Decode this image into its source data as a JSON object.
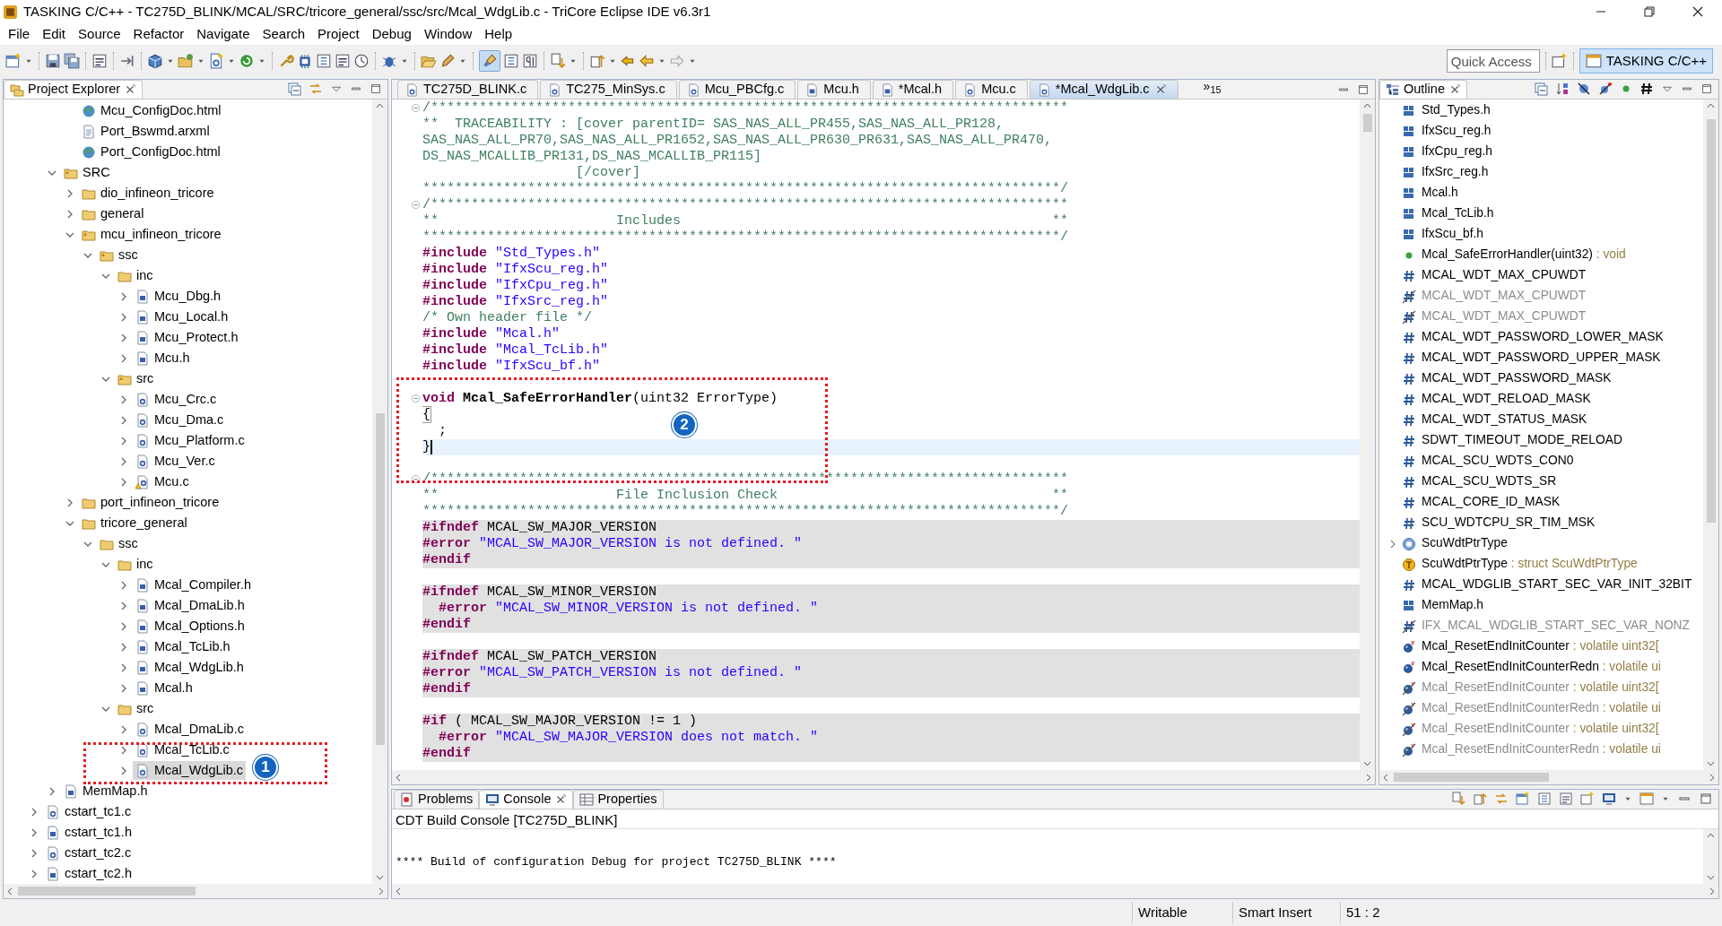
{
  "window": {
    "title": "TASKING C/C++ - TC275D_BLINK/MCAL/SRC/tricore_general/ssc/src/Mcal_WdgLib.c - TriCore Eclipse IDE v6.3r1"
  },
  "menu": [
    "File",
    "Edit",
    "Source",
    "Refactor",
    "Navigate",
    "Search",
    "Project",
    "Debug",
    "Window",
    "Help"
  ],
  "toolbar": {
    "toggle": {
      "on": true
    },
    "quick_access": {
      "placeholder": "Quick Access"
    },
    "perspectives": [
      {
        "label": "TASKING C/C++",
        "selected": true
      }
    ]
  },
  "project_explorer": {
    "title": "Project Explorer",
    "callout": "1",
    "tree": [
      {
        "kind": "hidden",
        "children": [
          {
            "kind": "hidden",
            "children": [
              {
                "label": "Mcu_ConfigDoc.html",
                "kind": "web",
                "selected": false
              },
              {
                "label": "Port_Bswmd.arxml",
                "kind": "doc",
                "selected": false
              },
              {
                "label": "Port_ConfigDoc.html",
                "kind": "web",
                "selected": false
              }
            ]
          },
          {
            "label": "SRC",
            "kind": "srcfolder",
            "expanded": true,
            "selected": false,
            "children": [
              {
                "label": "dio_infineon_tricore",
                "kind": "folder",
                "expanded": false,
                "selected": false
              },
              {
                "label": "general",
                "kind": "folder",
                "expanded": false,
                "selected": false
              },
              {
                "label": "mcu_infineon_tricore",
                "kind": "srcfolder",
                "expanded": true,
                "selected": false,
                "children": [
                  {
                    "label": "ssc",
                    "kind": "srcfolder",
                    "expanded": true,
                    "selected": false,
                    "children": [
                      {
                        "label": "inc",
                        "kind": "folder",
                        "expanded": true,
                        "selected": false,
                        "children": [
                          {
                            "label": "Mcu_Dbg.h",
                            "kind": "h",
                            "expanded": false,
                            "selected": false
                          },
                          {
                            "label": "Mcu_Local.h",
                            "kind": "h",
                            "expanded": false,
                            "selected": false
                          },
                          {
                            "label": "Mcu_Protect.h",
                            "kind": "h",
                            "expanded": false,
                            "selected": false
                          },
                          {
                            "label": "Mcu.h",
                            "kind": "h",
                            "expanded": false,
                            "selected": false
                          }
                        ]
                      },
                      {
                        "label": "src",
                        "kind": "srcfolder",
                        "expanded": true,
                        "selected": false,
                        "children": [
                          {
                            "label": "Mcu_Crc.c",
                            "kind": "c",
                            "expanded": false,
                            "selected": false
                          },
                          {
                            "label": "Mcu_Dma.c",
                            "kind": "c",
                            "expanded": false,
                            "selected": false
                          },
                          {
                            "label": "Mcu_Platform.c",
                            "kind": "c",
                            "expanded": false,
                            "selected": false
                          },
                          {
                            "label": "Mcu_Ver.c",
                            "kind": "c",
                            "expanded": false,
                            "selected": false
                          },
                          {
                            "label": "Mcu.c",
                            "kind": "c_warning",
                            "expanded": false,
                            "selected": false
                          }
                        ]
                      }
                    ]
                  }
                ]
              },
              {
                "label": "port_infineon_tricore",
                "kind": "folder",
                "expanded": false,
                "selected": false
              },
              {
                "label": "tricore_general",
                "kind": "folder",
                "expanded": true,
                "selected": false,
                "children": [
                  {
                    "label": "ssc",
                    "kind": "folder",
                    "expanded": true,
                    "selected": false,
                    "children": [
                      {
                        "label": "inc",
                        "kind": "folder",
                        "expanded": true,
                        "selected": false,
                        "children": [
                          {
                            "label": "Mcal_Compiler.h",
                            "kind": "h",
                            "expanded": false,
                            "selected": false
                          },
                          {
                            "label": "Mcal_DmaLib.h",
                            "kind": "h",
                            "expanded": false,
                            "selected": false
                          },
                          {
                            "label": "Mcal_Options.h",
                            "kind": "h",
                            "expanded": false,
                            "selected": false
                          },
                          {
                            "label": "Mcal_TcLib.h",
                            "kind": "h",
                            "expanded": false,
                            "selected": false
                          },
                          {
                            "label": "Mcal_WdgLib.h",
                            "kind": "h",
                            "expanded": false,
                            "selected": false
                          },
                          {
                            "label": "Mcal.h",
                            "kind": "h",
                            "expanded": false,
                            "selected": false
                          }
                        ]
                      },
                      {
                        "label": "src",
                        "kind": "folder",
                        "expanded": true,
                        "selected": false,
                        "children": [
                          {
                            "label": "Mcal_DmaLib.c",
                            "kind": "c",
                            "expanded": false,
                            "selected": false
                          },
                          {
                            "label": "Mcal_TcLib.c",
                            "kind": "c",
                            "expanded": false,
                            "selected": false
                          },
                          {
                            "label": "Mcal_WdgLib.c",
                            "kind": "c",
                            "expanded": false,
                            "selected": true
                          }
                        ]
                      }
                    ]
                  }
                ]
              }
            ]
          },
          {
            "label": "MemMap.h",
            "kind": "h",
            "expanded": false,
            "selected": false
          }
        ]
      },
      {
        "label": "cstart_tc1.c",
        "kind": "c",
        "expanded": false,
        "selected": false
      },
      {
        "label": "cstart_tc1.h",
        "kind": "h",
        "expanded": false,
        "selected": false
      },
      {
        "label": "cstart_tc2.c",
        "kind": "c",
        "expanded": false,
        "selected": false
      },
      {
        "label": "cstart_tc2.h",
        "kind": "h",
        "expanded": false,
        "selected": false
      }
    ]
  },
  "editor": {
    "tabs": [
      {
        "label": "TC275D_BLINK.c",
        "kind": "c",
        "selected": false
      },
      {
        "label": "TC275_MinSys.c",
        "kind": "c",
        "selected": false
      },
      {
        "label": "Mcu_PBCfg.c",
        "kind": "c",
        "selected": false
      },
      {
        "label": "Mcu.h",
        "kind": "h",
        "selected": false
      },
      {
        "label": "*Mcal.h",
        "kind": "h",
        "selected": false
      },
      {
        "label": "Mcu.c",
        "kind": "c",
        "selected": false
      },
      {
        "label": "*Mcal_WdgLib.c",
        "kind": "c",
        "selected": true
      }
    ],
    "overflow": {
      "mark": "»",
      "count": "15"
    },
    "callout": "2",
    "lines": [
      {
        "fold": true,
        "inactive": false,
        "current": false,
        "segments": [
          {
            "kind": "comment",
            "text": "/*******************************************************************************"
          }
        ]
      },
      {
        "fold": false,
        "inactive": false,
        "current": false,
        "segments": [
          {
            "kind": "comment",
            "text": "**  TRACEABILITY : [cover parentID= SAS_NAS_ALL_PR455,SAS_NAS_ALL_PR128,"
          }
        ]
      },
      {
        "fold": false,
        "inactive": false,
        "current": false,
        "segments": [
          {
            "kind": "comment",
            "text": "SAS_NAS_ALL_PR70,SAS_NAS_ALL_PR1652,SAS_NAS_ALL_PR630_PR631,SAS_NAS_ALL_PR470,"
          }
        ]
      },
      {
        "fold": false,
        "inactive": false,
        "current": false,
        "segments": [
          {
            "kind": "comment",
            "text": "DS_NAS_MCALLIB_PR131,DS_NAS_MCALLIB_PR115]"
          }
        ]
      },
      {
        "fold": false,
        "inactive": false,
        "current": false,
        "segments": [
          {
            "kind": "comment",
            "text": "                   [/cover]"
          }
        ]
      },
      {
        "fold": false,
        "inactive": false,
        "current": false,
        "segments": [
          {
            "kind": "comment",
            "text": "*******************************************************************************/"
          }
        ]
      },
      {
        "fold": true,
        "inactive": false,
        "current": false,
        "segments": [
          {
            "kind": "comment",
            "text": "/*******************************************************************************"
          }
        ]
      },
      {
        "fold": false,
        "inactive": false,
        "current": false,
        "segments": [
          {
            "kind": "comment",
            "text": "**                      Includes                                              **"
          }
        ]
      },
      {
        "fold": false,
        "inactive": false,
        "current": false,
        "segments": [
          {
            "kind": "comment",
            "text": "*******************************************************************************/"
          }
        ]
      },
      {
        "fold": false,
        "inactive": false,
        "current": false,
        "segments": [
          {
            "kind": "directive",
            "text": "#include"
          },
          {
            "kind": "string",
            "text": " \"Std_Types.h\""
          }
        ]
      },
      {
        "fold": false,
        "inactive": false,
        "current": false,
        "segments": [
          {
            "kind": "directive",
            "text": "#include"
          },
          {
            "kind": "string",
            "text": " \"IfxScu_reg.h\""
          }
        ]
      },
      {
        "fold": false,
        "inactive": false,
        "current": false,
        "segments": [
          {
            "kind": "directive",
            "text": "#include"
          },
          {
            "kind": "string",
            "text": " \"IfxCpu_reg.h\""
          }
        ]
      },
      {
        "fold": false,
        "inactive": false,
        "current": false,
        "segments": [
          {
            "kind": "directive",
            "text": "#include"
          },
          {
            "kind": "string",
            "text": " \"IfxSrc_reg.h\""
          }
        ]
      },
      {
        "fold": false,
        "inactive": false,
        "current": false,
        "segments": [
          {
            "kind": "comment",
            "text": "/* Own header file */"
          }
        ]
      },
      {
        "fold": false,
        "inactive": false,
        "current": false,
        "segments": [
          {
            "kind": "directive",
            "text": "#include"
          },
          {
            "kind": "string",
            "text": " \"Mcal.h\""
          }
        ]
      },
      {
        "fold": false,
        "inactive": false,
        "current": false,
        "segments": [
          {
            "kind": "directive",
            "text": "#include"
          },
          {
            "kind": "string",
            "text": " \"Mcal_TcLib.h\""
          }
        ]
      },
      {
        "fold": false,
        "inactive": false,
        "current": false,
        "segments": [
          {
            "kind": "directive",
            "text": "#include"
          },
          {
            "kind": "string",
            "text": " \"IfxScu_bf.h\""
          }
        ]
      },
      {
        "fold": false,
        "inactive": false,
        "current": false
      },
      {
        "fold": true,
        "inactive": false,
        "current": false,
        "segments": [
          {
            "kind": "keyword",
            "text": "void "
          },
          {
            "kind": "func",
            "text": "Mcal_SafeErrorHandler"
          },
          {
            "kind": "plain",
            "text": "(uint32 ErrorType)"
          }
        ]
      },
      {
        "fold": false,
        "inactive": false,
        "current": false,
        "segments": [
          {
            "kind": "match",
            "text": "{"
          }
        ]
      },
      {
        "fold": false,
        "inactive": false,
        "current": false,
        "segments": [
          {
            "kind": "plain",
            "text": "  ;"
          }
        ]
      },
      {
        "fold": false,
        "inactive": false,
        "current": true,
        "segments": [
          {
            "kind": "plain",
            "text": "}"
          }
        ]
      },
      {
        "fold": false,
        "inactive": false,
        "current": false
      },
      {
        "fold": true,
        "inactive": false,
        "current": false,
        "segments": [
          {
            "kind": "comment",
            "text": "/*******************************************************************************"
          }
        ]
      },
      {
        "fold": false,
        "inactive": false,
        "current": false,
        "segments": [
          {
            "kind": "comment",
            "text": "**                      File Inclusion Check                                  **"
          }
        ]
      },
      {
        "fold": false,
        "inactive": false,
        "current": false,
        "segments": [
          {
            "kind": "comment",
            "text": "*******************************************************************************/"
          }
        ]
      },
      {
        "fold": false,
        "inactive": true,
        "current": false,
        "segments": [
          {
            "kind": "directive",
            "text": "#ifndef"
          },
          {
            "kind": "plain",
            "text": " MCAL_SW_MAJOR_VERSION"
          }
        ]
      },
      {
        "fold": false,
        "inactive": true,
        "current": false,
        "segments": [
          {
            "kind": "directive",
            "text": "#error"
          },
          {
            "kind": "string",
            "text": " \"MCAL_SW_MAJOR_VERSION is not defined. \""
          }
        ]
      },
      {
        "fold": false,
        "inactive": true,
        "current": false,
        "segments": [
          {
            "kind": "directive",
            "text": "#endif"
          }
        ]
      },
      {
        "fold": false,
        "inactive": false,
        "current": false
      },
      {
        "fold": false,
        "inactive": true,
        "current": false,
        "segments": [
          {
            "kind": "directive",
            "text": "#ifndef"
          },
          {
            "kind": "plain",
            "text": " MCAL_SW_MINOR_VERSION"
          }
        ]
      },
      {
        "fold": false,
        "inactive": true,
        "current": false,
        "segments": [
          {
            "kind": "directive",
            "text": "  #error"
          },
          {
            "kind": "string",
            "text": " \"MCAL_SW_MINOR_VERSION is not defined. \""
          }
        ]
      },
      {
        "fold": false,
        "inactive": true,
        "current": false,
        "segments": [
          {
            "kind": "directive",
            "text": "#endif"
          }
        ]
      },
      {
        "fold": false,
        "inactive": false,
        "current": false
      },
      {
        "fold": false,
        "inactive": true,
        "current": false,
        "segments": [
          {
            "kind": "directive",
            "text": "#ifndef"
          },
          {
            "kind": "plain",
            "text": " MCAL_SW_PATCH_VERSION"
          }
        ]
      },
      {
        "fold": false,
        "inactive": true,
        "current": false,
        "segments": [
          {
            "kind": "directive",
            "text": "#error"
          },
          {
            "kind": "string",
            "text": " \"MCAL_SW_PATCH_VERSION is not defined. \""
          }
        ]
      },
      {
        "fold": false,
        "inactive": true,
        "current": false,
        "segments": [
          {
            "kind": "directive",
            "text": "#endif"
          }
        ]
      },
      {
        "fold": false,
        "inactive": false,
        "current": false
      },
      {
        "fold": false,
        "inactive": true,
        "current": false,
        "segments": [
          {
            "kind": "directive",
            "text": "#if"
          },
          {
            "kind": "plain",
            "text": " ( MCAL_SW_MAJOR_VERSION != 1 )"
          }
        ]
      },
      {
        "fold": false,
        "inactive": true,
        "current": false,
        "segments": [
          {
            "kind": "directive",
            "text": "  #error"
          },
          {
            "kind": "string",
            "text": " \"MCAL_SW_MAJOR_VERSION does not match. \""
          }
        ]
      },
      {
        "fold": false,
        "inactive": true,
        "current": false,
        "segments": [
          {
            "kind": "directive",
            "text": "#endif"
          }
        ]
      }
    ]
  },
  "outline": {
    "title": "Outline",
    "items": [
      {
        "label": "Std_Types.h",
        "kind": "include",
        "disabled": false
      },
      {
        "label": "IfxScu_reg.h",
        "kind": "include",
        "disabled": false
      },
      {
        "label": "IfxCpu_reg.h",
        "kind": "include",
        "disabled": false
      },
      {
        "label": "IfxSrc_reg.h",
        "kind": "include",
        "disabled": false
      },
      {
        "label": "Mcal.h",
        "kind": "include",
        "disabled": false
      },
      {
        "label": "Mcal_TcLib.h",
        "kind": "include",
        "disabled": false
      },
      {
        "label": "IfxScu_bf.h",
        "kind": "include",
        "disabled": false
      },
      {
        "label": "Mcal_SafeErrorHandler(uint32)",
        "type": " : void",
        "kind": "function",
        "disabled": false
      },
      {
        "label": "MCAL_WDT_MAX_CPUWDT",
        "kind": "macro",
        "disabled": false
      },
      {
        "label": "MCAL_WDT_MAX_CPUWDT",
        "kind": "macro",
        "disabled": true
      },
      {
        "label": "MCAL_WDT_MAX_CPUWDT",
        "kind": "macro",
        "disabled": true
      },
      {
        "label": "MCAL_WDT_PASSWORD_LOWER_MASK",
        "kind": "macro",
        "disabled": false
      },
      {
        "label": "MCAL_WDT_PASSWORD_UPPER_MASK",
        "kind": "macro",
        "disabled": false
      },
      {
        "label": "MCAL_WDT_PASSWORD_MASK",
        "kind": "macro",
        "disabled": false
      },
      {
        "label": "MCAL_WDT_RELOAD_MASK",
        "kind": "macro",
        "disabled": false
      },
      {
        "label": "MCAL_WDT_STATUS_MASK",
        "kind": "macro",
        "disabled": false
      },
      {
        "label": "SDWT_TIMEOUT_MODE_RELOAD",
        "kind": "macro",
        "disabled": false
      },
      {
        "label": "MCAL_SCU_WDTS_CON0",
        "kind": "macro",
        "disabled": false
      },
      {
        "label": "MCAL_SCU_WDTS_SR",
        "kind": "macro",
        "disabled": false
      },
      {
        "label": "MCAL_CORE_ID_MASK",
        "kind": "macro",
        "disabled": false
      },
      {
        "label": "SCU_WDTCPU_SR_TIM_MSK",
        "kind": "macro",
        "disabled": false
      },
      {
        "label": "ScuWdtPtrType",
        "kind": "struct",
        "disabled": false,
        "expanded": false
      },
      {
        "label": "ScuWdtPtrType",
        "type": " : struct ScuWdtPtrType",
        "kind": "typedef",
        "disabled": false
      },
      {
        "label": "MCAL_WDGLIB_START_SEC_VAR_INIT_32BIT",
        "kind": "macro",
        "disabled": false
      },
      {
        "label": "MemMap.h",
        "kind": "include",
        "disabled": false
      },
      {
        "label": "IFX_MCAL_WDGLIB_START_SEC_VAR_NONZ",
        "kind": "macro",
        "disabled": true
      },
      {
        "label": "Mcal_ResetEndInitCounter",
        "type": " : volatile uint32[",
        "kind": "variable",
        "disabled": false
      },
      {
        "label": "Mcal_ResetEndInitCounterRedn",
        "type": " : volatile ui",
        "kind": "variable",
        "disabled": false
      },
      {
        "label": "Mcal_ResetEndInitCounter",
        "type": " : volatile uint32[",
        "kind": "variable",
        "disabled": true
      },
      {
        "label": "Mcal_ResetEndInitCounterRedn",
        "type": " : volatile ui",
        "kind": "variable",
        "disabled": true
      },
      {
        "label": "Mcal_ResetEndInitCounter",
        "type": " : volatile uint32[",
        "kind": "variable",
        "disabled": true
      },
      {
        "label": "Mcal_ResetEndInitCounterRedn",
        "type": " : volatile ui",
        "kind": "variable",
        "disabled": true
      }
    ]
  },
  "console": {
    "tabs": [
      {
        "label": "Problems",
        "selected": false
      },
      {
        "label": "Console",
        "selected": true
      },
      {
        "label": "Properties",
        "selected": false
      }
    ],
    "header": "CDT Build Console [TC275D_BLINK]",
    "lines": [
      "**** Build of configuration Debug for project TC275D_BLINK ****"
    ]
  },
  "status_bar": [
    "Writable",
    "Smart Insert",
    "51 : 2"
  ]
}
